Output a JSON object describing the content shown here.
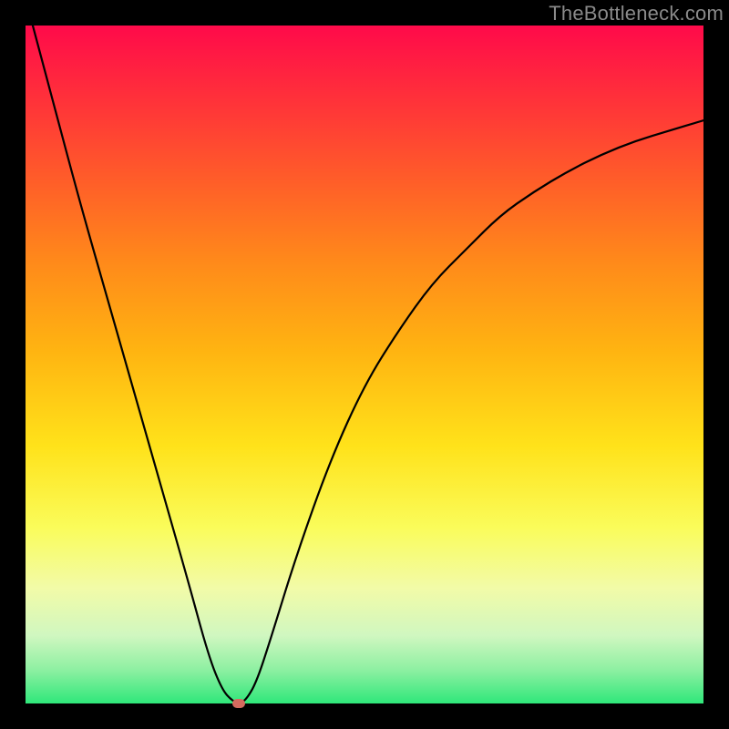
{
  "watermark_text": "TheBottleneck.com",
  "colors": {
    "frame_bg": "#000000",
    "curve": "#000000",
    "marker": "#d46a5e",
    "watermark": "#8a8a8a"
  },
  "chart_data": {
    "type": "line",
    "title": "",
    "xlabel": "",
    "ylabel": "",
    "xlim": [
      0,
      100
    ],
    "ylim": [
      0,
      100
    ],
    "grid": false,
    "series": [
      {
        "name": "bottleneck-curve",
        "x": [
          0,
          4,
          8,
          12,
          16,
          20,
          24,
          27,
          29,
          30.5,
          31.5,
          32.5,
          34,
          36,
          40,
          45,
          50,
          55,
          60,
          65,
          70,
          75,
          80,
          85,
          90,
          95,
          100
        ],
        "y": [
          104,
          89,
          74,
          60,
          46,
          32,
          18,
          7,
          2,
          0.4,
          0,
          0.5,
          3,
          9,
          22,
          36,
          47,
          55,
          62,
          67,
          72,
          75.5,
          78.5,
          81,
          83,
          84.5,
          86
        ]
      }
    ],
    "marker": {
      "x": 31.5,
      "y": 0
    }
  }
}
